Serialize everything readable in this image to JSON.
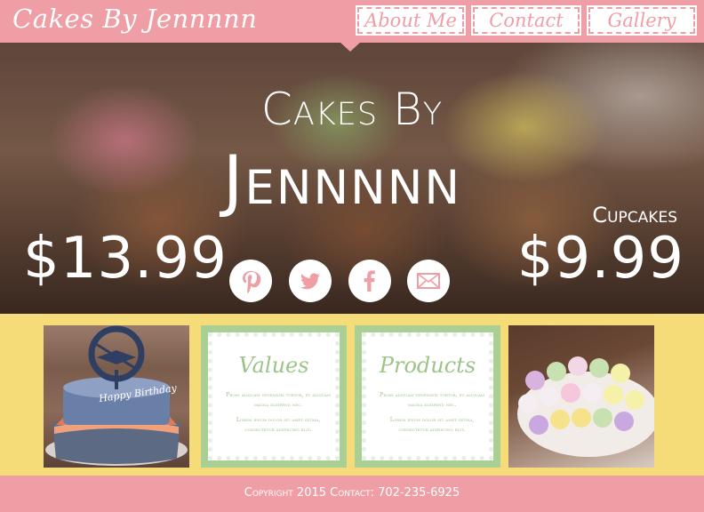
{
  "brand": {
    "logo_text": "Cakes By Jennnnn"
  },
  "nav": {
    "items": [
      {
        "label": "About Me"
      },
      {
        "label": "Contact"
      },
      {
        "label": "Gallery"
      }
    ]
  },
  "hero": {
    "title_line1": "Cakes By",
    "title_line2": "Jennnnn",
    "price_left": "$13.99",
    "right_label": "Cupcakes",
    "price_right": "$9.99",
    "social_icons": [
      "pinterest-icon",
      "twitter-icon",
      "facebook-icon",
      "email-icon"
    ]
  },
  "tiles": {
    "values": {
      "title": "Values",
      "text1": "Proin aliquam venenatis tortor, et aliquam magna eleifend nec.",
      "text2": "Lorem ipsum dolor sit amet setma, consectetur adipiscing elit."
    },
    "products": {
      "title": "Products",
      "text1": "Proin aliquam venenatis tortor, et aliquam magna eleifend nec.",
      "text2": "Lorem ipsum dolor sit amet setma, consectetur adipiscing elit."
    },
    "cake_topper_text": "Happy Birthday"
  },
  "footer": {
    "text": "Copyright 2015   Contact: 702-235-6925"
  },
  "colors": {
    "pink": "#ee9ea4",
    "yellow": "#f5dc78",
    "green": "#a9cf94",
    "white": "#ffffff"
  }
}
